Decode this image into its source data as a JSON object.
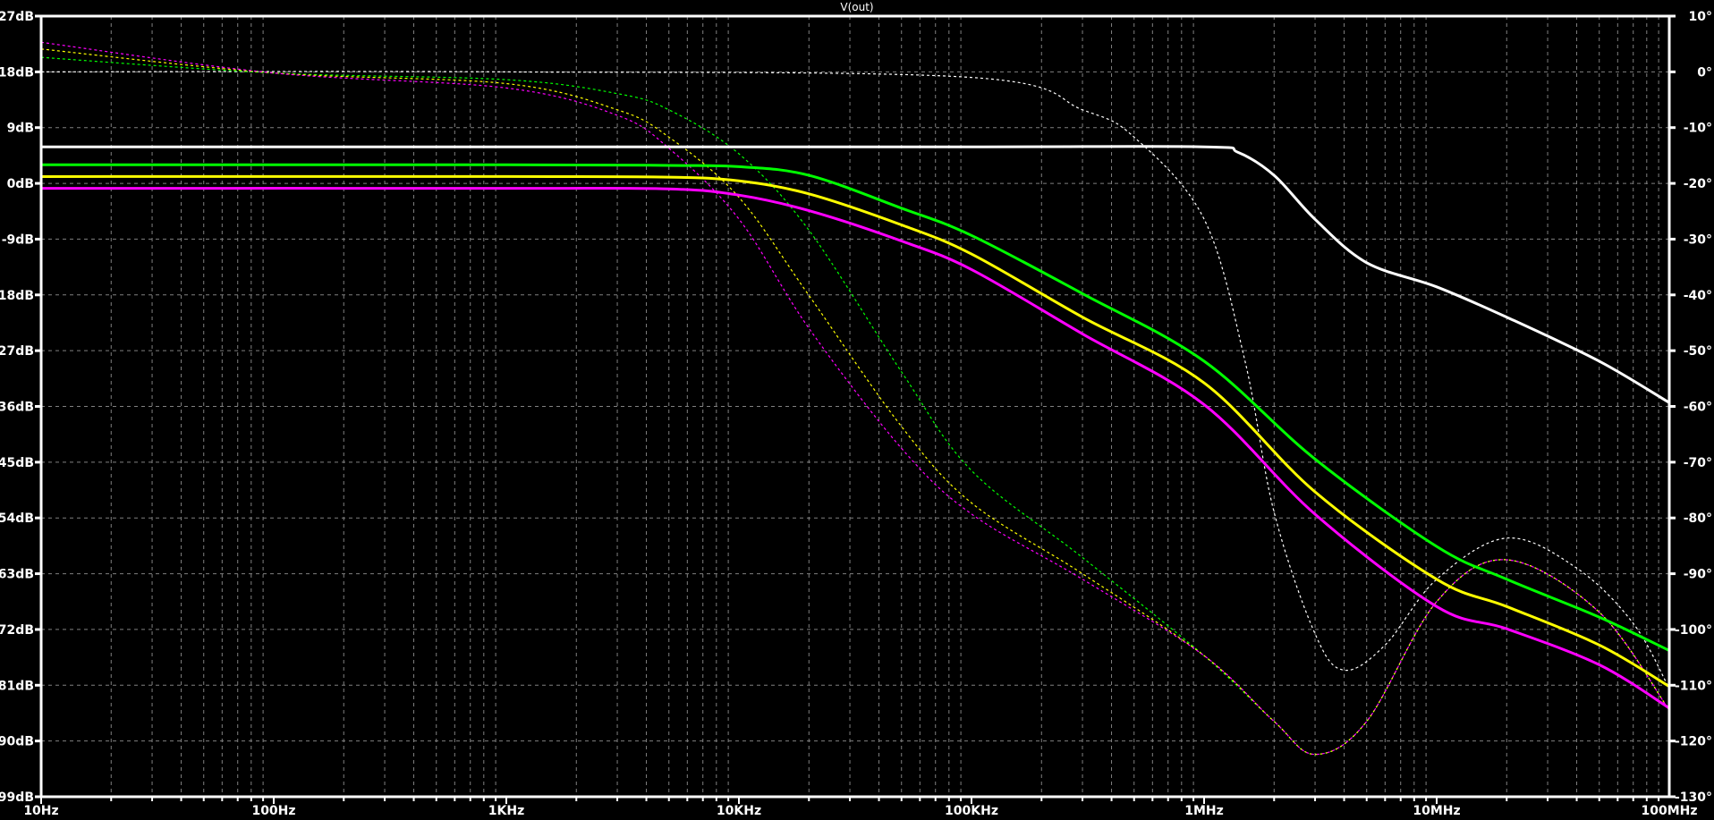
{
  "chart_data": {
    "type": "line",
    "title": "V(out)",
    "xlabel": "",
    "ylabel": "",
    "xscale": "log",
    "xlim": [
      10,
      100000000
    ],
    "ylim": [
      -99,
      27
    ],
    "y2lim": [
      -130,
      10
    ],
    "grid": true,
    "x_ticks": [
      "10Hz",
      "100Hz",
      "1KHz",
      "10KHz",
      "100KHz",
      "1MHz",
      "10MHz",
      "100MHz"
    ],
    "y_ticks": [
      "27dB",
      "18dB",
      "9dB",
      "0dB",
      "-9dB",
      "-18dB",
      "-27dB",
      "-36dB",
      "-45dB",
      "-54dB",
      "-63dB",
      "-72dB",
      "-81dB",
      "-90dB",
      "-99dB"
    ],
    "y2_ticks": [
      "10°",
      "0°",
      "-10°",
      "-20°",
      "-30°",
      "-40°",
      "-50°",
      "-60°",
      "-70°",
      "-80°",
      "-90°",
      "-100°",
      "-110°",
      "-120°",
      "-130°"
    ],
    "series": [
      {
        "name": "magnitude-white",
        "axis": "dB",
        "style": "solid",
        "color": "#ffffff",
        "points": [
          [
            10,
            5.9
          ],
          [
            1000,
            5.9
          ],
          [
            100000,
            5.9
          ],
          [
            1000000,
            5.9
          ],
          [
            1400000,
            5.0
          ],
          [
            2000000,
            1.3
          ],
          [
            3000000,
            -5.8
          ],
          [
            5000000,
            -12.8
          ],
          [
            10000000,
            -16.7
          ],
          [
            20000000,
            -21.6
          ],
          [
            50000000,
            -28.7
          ],
          [
            100000000,
            -35.4
          ]
        ]
      },
      {
        "name": "magnitude-green",
        "axis": "dB",
        "style": "solid",
        "color": "#00ff00",
        "points": [
          [
            10,
            3.0
          ],
          [
            1000,
            3.0
          ],
          [
            5000,
            2.9
          ],
          [
            10000,
            2.7
          ],
          [
            20000,
            1.3
          ],
          [
            50000,
            -4
          ],
          [
            100000,
            -8.4
          ],
          [
            300000,
            -17.8
          ],
          [
            1000000,
            -28.7
          ],
          [
            3000000,
            -44.5
          ],
          [
            10000000,
            -58.6
          ],
          [
            20000000,
            -63.9
          ],
          [
            50000000,
            -70
          ],
          [
            100000000,
            -75.4
          ]
        ]
      },
      {
        "name": "magnitude-yellow",
        "axis": "dB",
        "style": "solid",
        "color": "#ffff00",
        "points": [
          [
            10,
            1.1
          ],
          [
            1000,
            1.1
          ],
          [
            5000,
            1.0
          ],
          [
            10000,
            0.4
          ],
          [
            20000,
            -1.7
          ],
          [
            50000,
            -6.7
          ],
          [
            100000,
            -11.4
          ],
          [
            300000,
            -21.6
          ],
          [
            1000000,
            -32.2
          ],
          [
            3000000,
            -49.8
          ],
          [
            10000000,
            -63.9
          ],
          [
            20000000,
            -68.3
          ],
          [
            50000000,
            -74.5
          ],
          [
            100000000,
            -81.2
          ]
        ]
      },
      {
        "name": "magnitude-magenta",
        "axis": "dB",
        "style": "solid",
        "color": "#ff00ff",
        "points": [
          [
            10,
            -0.8
          ],
          [
            1000,
            -0.8
          ],
          [
            5000,
            -0.9
          ],
          [
            10000,
            -1.9
          ],
          [
            20000,
            -4.4
          ],
          [
            50000,
            -9.3
          ],
          [
            100000,
            -13.9
          ],
          [
            300000,
            -24.3
          ],
          [
            1000000,
            -35.7
          ],
          [
            3000000,
            -53.4
          ],
          [
            10000000,
            -68.3
          ],
          [
            20000000,
            -71.9
          ],
          [
            50000000,
            -77.7
          ],
          [
            100000000,
            -84.7
          ]
        ]
      },
      {
        "name": "phase-white",
        "axis": "deg",
        "style": "dotted",
        "color": "#ffffff",
        "points": [
          [
            10,
            0
          ],
          [
            1000,
            0
          ],
          [
            100000,
            -1
          ],
          [
            300000,
            -6.8
          ],
          [
            500000,
            -11.7
          ],
          [
            1000000,
            -26.4
          ],
          [
            1500000,
            -51.9
          ],
          [
            2000000,
            -79
          ],
          [
            3000000,
            -100.8
          ],
          [
            4000000,
            -107.3
          ],
          [
            6000000,
            -102.8
          ],
          [
            10000000,
            -91
          ],
          [
            20000000,
            -83.6
          ],
          [
            40000000,
            -89
          ],
          [
            70000000,
            -98.9
          ],
          [
            100000000,
            -110.6
          ]
        ]
      },
      {
        "name": "phase-green",
        "axis": "deg",
        "style": "dotted",
        "color": "#00ff00",
        "points": [
          [
            10,
            2.6
          ],
          [
            100,
            -0.2
          ],
          [
            1000,
            -1.4
          ],
          [
            3000,
            -3.9
          ],
          [
            5000,
            -6.8
          ],
          [
            10000,
            -14.7
          ],
          [
            20000,
            -28.4
          ],
          [
            50000,
            -53.8
          ],
          [
            100000,
            -71.5
          ],
          [
            300000,
            -87.1
          ],
          [
            1000000,
            -104.7
          ],
          [
            2000000,
            -116.5
          ],
          [
            3000000,
            -122.4
          ],
          [
            5000000,
            -116.5
          ],
          [
            10000000,
            -95
          ],
          [
            20000000,
            -87.5
          ],
          [
            50000000,
            -96.9
          ],
          [
            100000000,
            -114.5
          ]
        ]
      },
      {
        "name": "phase-yellow",
        "axis": "deg",
        "style": "dotted",
        "color": "#ffff00",
        "points": [
          [
            10,
            4.1
          ],
          [
            100,
            -0.2
          ],
          [
            1000,
            -2.1
          ],
          [
            3000,
            -6.8
          ],
          [
            5000,
            -11.7
          ],
          [
            10000,
            -22.5
          ],
          [
            20000,
            -40.1
          ],
          [
            50000,
            -63.6
          ],
          [
            100000,
            -77.3
          ],
          [
            300000,
            -90
          ],
          [
            1000000,
            -104.7
          ],
          [
            2000000,
            -116.5
          ],
          [
            3000000,
            -122.4
          ],
          [
            5000000,
            -116.5
          ],
          [
            10000000,
            -95
          ],
          [
            20000000,
            -87.5
          ],
          [
            50000000,
            -96.9
          ],
          [
            100000000,
            -114.5
          ]
        ]
      },
      {
        "name": "phase-magenta",
        "axis": "deg",
        "style": "dotted",
        "color": "#ff00ff",
        "points": [
          [
            10,
            5.3
          ],
          [
            100,
            -0.2
          ],
          [
            1000,
            -2.9
          ],
          [
            3000,
            -7.8
          ],
          [
            5000,
            -13.7
          ],
          [
            10000,
            -26.4
          ],
          [
            20000,
            -46
          ],
          [
            50000,
            -67.5
          ],
          [
            100000,
            -79.3
          ],
          [
            300000,
            -91
          ],
          [
            1000000,
            -104.7
          ],
          [
            2000000,
            -116.5
          ],
          [
            3000000,
            -122.4
          ],
          [
            5000000,
            -116.5
          ],
          [
            10000000,
            -95
          ],
          [
            20000000,
            -87.5
          ],
          [
            50000000,
            -96.9
          ],
          [
            100000000,
            -114.5
          ]
        ]
      }
    ]
  }
}
